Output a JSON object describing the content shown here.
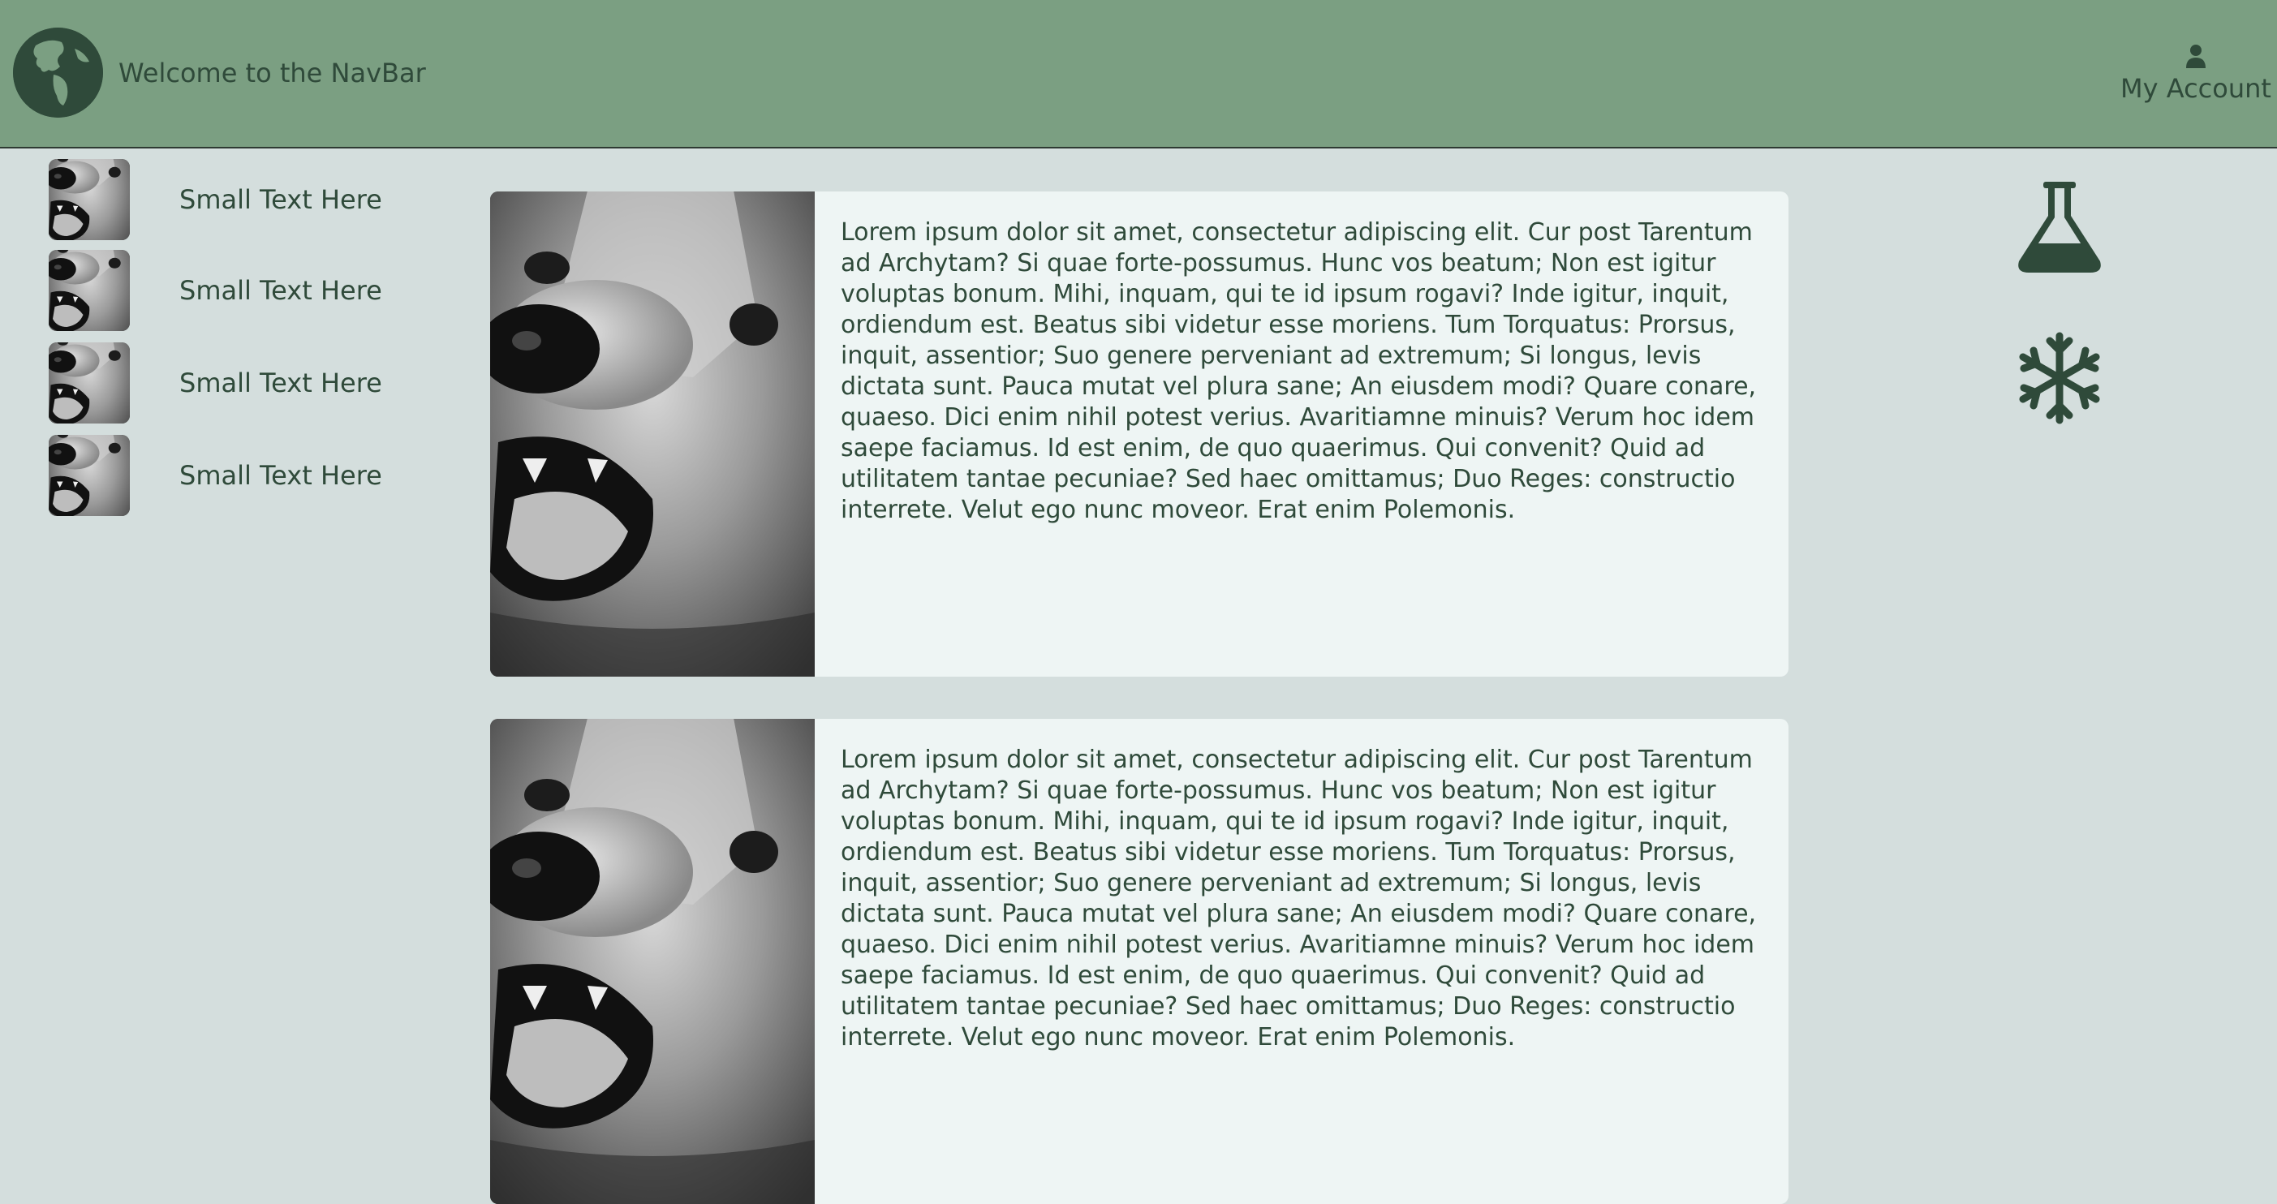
{
  "navbar": {
    "logo_icon": "globe-icon",
    "title": "Welcome to the NavBar",
    "account_icon": "user-icon",
    "account_label": "My Account",
    "background": "#7b9f82"
  },
  "sidebar": {
    "items": [
      {
        "label": "Small Text Here",
        "icon": "bear-thumbnail"
      },
      {
        "label": "Small Text Here",
        "icon": "bear-thumbnail"
      },
      {
        "label": "Small Text Here",
        "icon": "bear-thumbnail"
      },
      {
        "label": "Small Text Here",
        "icon": "bear-thumbnail"
      }
    ]
  },
  "cards": [
    {
      "image": "bear-photo",
      "text": "Lorem ipsum dolor sit amet, consectetur adipiscing elit. Cur post Tarentum ad Archytam? Si quae forte-possumus. Hunc vos beatum; Non est igitur voluptas bonum. Mihi, inquam, qui te id ipsum rogavi? Inde igitur, inquit, ordiendum est. Beatus sibi videtur esse moriens. Tum Torquatus: Prorsus, inquit, assentior; Suo genere perveniant ad extremum; Si longus, levis dictata sunt. Pauca mutat vel plura sane; An eiusdem modi? Quare conare, quaeso. Dici enim nihil potest verius. Avaritiamne minuis? Verum hoc idem saepe faciamus. Id est enim, de quo quaerimus. Qui convenit? Quid ad utilitatem tantae pecuniae? Sed haec omittamus; Duo Reges: constructio interrete. Velut ego nunc moveor. Erat enim Polemonis."
    },
    {
      "image": "bear-photo",
      "text": "Lorem ipsum dolor sit amet, consectetur adipiscing elit. Cur post Tarentum ad Archytam? Si quae forte-possumus. Hunc vos beatum; Non est igitur voluptas bonum. Mihi, inquam, qui te id ipsum rogavi? Inde igitur, inquit, ordiendum est. Beatus sibi videtur esse moriens. Tum Torquatus: Prorsus, inquit, assentior; Suo genere perveniant ad extremum; Si longus, levis dictata sunt. Pauca mutat vel plura sane; An eiusdem modi? Quare conare, quaeso. Dici enim nihil potest verius. Avaritiamne minuis? Verum hoc idem saepe faciamus. Id est enim, de quo quaerimus. Qui convenit? Quid ad utilitatem tantae pecuniae? Sed haec omittamus; Duo Reges: constructio interrete. Velut ego nunc moveor. Erat enim Polemonis."
    }
  ],
  "right_panel": {
    "icons": [
      "flask-icon",
      "snowflake-icon"
    ]
  },
  "colors": {
    "page_background": "#d4dedd",
    "card_background": "#eef5f4",
    "accent_dark": "#2f4a3a"
  }
}
